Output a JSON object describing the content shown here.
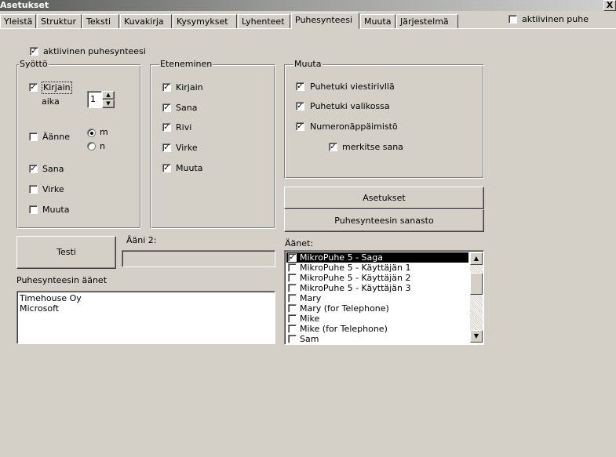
{
  "window": {
    "title": "Asetukset",
    "close_label": "X"
  },
  "tabs": [
    "Yleistä",
    "Struktur",
    "Teksti",
    "Kuvakirja",
    "Kysymykset",
    "Lyhenteet",
    "Puhesynteesi",
    "Muuta",
    "Järjestelmä"
  ],
  "active_tab": "Puhesynteesi",
  "aktiivinen_puhe": {
    "label": "aktiivinen puhe",
    "checked": false
  },
  "aktiivinen_puhesynteesi": {
    "label": "aktiivinen puhesynteesi",
    "checked": true
  },
  "syotto": {
    "title": "Syöttö",
    "kirjain": {
      "label": "Kirjain",
      "checked": true
    },
    "aika": {
      "label": "aika",
      "value": "1"
    },
    "aanne": {
      "label": "Äänne",
      "checked": false
    },
    "radio_m": {
      "label": "m",
      "selected": true
    },
    "radio_n": {
      "label": "n",
      "selected": false
    },
    "sana": {
      "label": "Sana",
      "checked": true
    },
    "virke": {
      "label": "Virke",
      "checked": false
    },
    "muuta": {
      "label": "Muuta",
      "checked": false
    }
  },
  "eteneminen": {
    "title": "Eteneminen",
    "items": [
      {
        "label": "Kirjain",
        "checked": true
      },
      {
        "label": "Sana",
        "checked": true
      },
      {
        "label": "Rivi",
        "checked": true
      },
      {
        "label": "Virke",
        "checked": true
      },
      {
        "label": "Muuta",
        "checked": true
      }
    ]
  },
  "muuta_group": {
    "title": "Muuta",
    "items": [
      {
        "label": "Puhetuki viestirivllä",
        "checked": true
      },
      {
        "label": "Puhetuki valikossa",
        "checked": true
      },
      {
        "label": "Numeronäppäimistö",
        "checked": true
      }
    ],
    "merkitse_sana": {
      "label": "merkitse sana",
      "checked": true
    }
  },
  "buttons": {
    "asetukset": "Asetukset",
    "sanasto": "Puhesynteesin sanasto",
    "testi": "Testi"
  },
  "aani2": {
    "label": "Ääni 2:",
    "value": ""
  },
  "puhesynteesin_aanet": {
    "label": "Puhesynteesin äänet",
    "items": [
      "Timehouse Oy",
      "Microsoft"
    ]
  },
  "aanet": {
    "label": "Äänet:",
    "items": [
      {
        "label": "MikroPuhe 5 - Saga",
        "checked": true,
        "selected": true
      },
      {
        "label": "MikroPuhe 5 - Käyttäjän 1",
        "checked": false,
        "selected": false
      },
      {
        "label": "MikroPuhe 5 - Käyttäjän 2",
        "checked": false,
        "selected": false
      },
      {
        "label": "MikroPuhe 5 - Käyttäjän 3",
        "checked": false,
        "selected": false
      },
      {
        "label": "Mary",
        "checked": false,
        "selected": false
      },
      {
        "label": "Mary (for Telephone)",
        "checked": false,
        "selected": false
      },
      {
        "label": "Mike",
        "checked": false,
        "selected": false
      },
      {
        "label": "Mike (for Telephone)",
        "checked": false,
        "selected": false
      },
      {
        "label": "Sam",
        "checked": false,
        "selected": false
      }
    ]
  }
}
